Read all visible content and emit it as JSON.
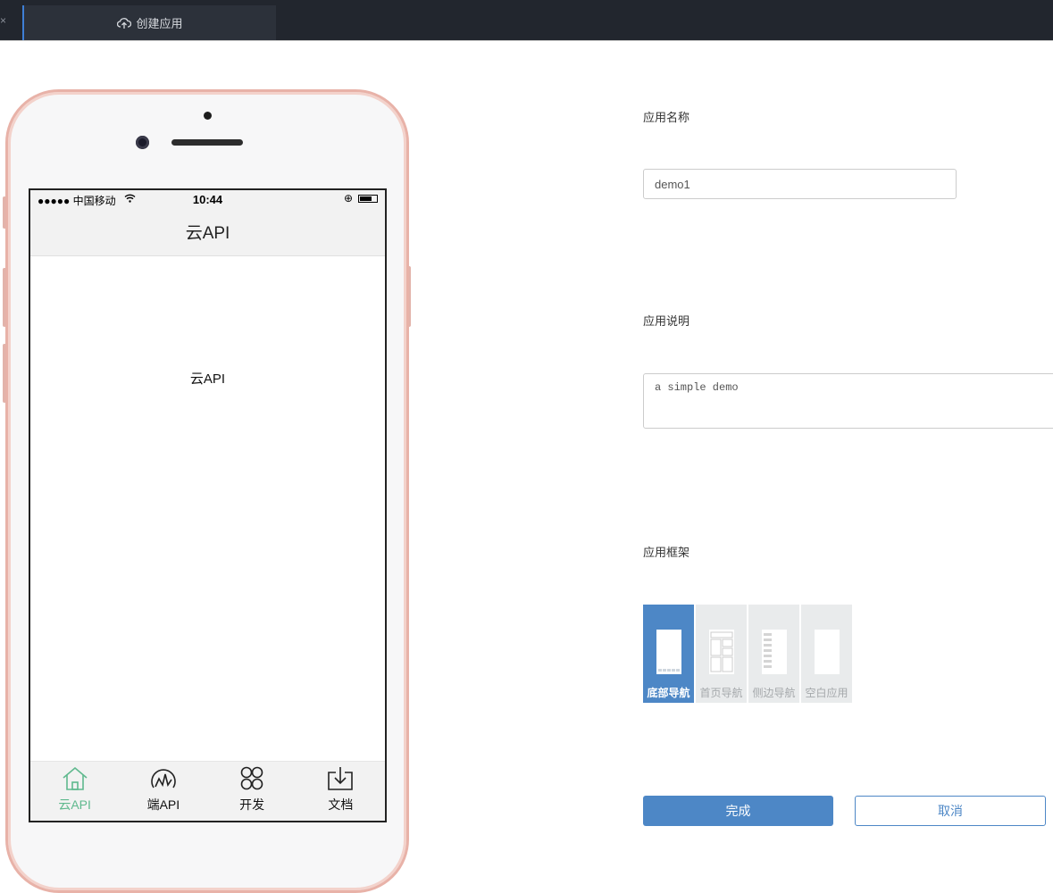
{
  "window": {
    "close_glyph": "×",
    "tab_title": "创建应用",
    "tab_icon": "cloud-upload-icon"
  },
  "phone": {
    "status": {
      "carrier": "●●●●● 中国移动",
      "time": "10:44",
      "lock": "⊕"
    },
    "nav_title": "云API",
    "content_text": "云API",
    "tabs": [
      {
        "label": "云API",
        "icon": "home-icon",
        "active": true
      },
      {
        "label": "端API",
        "icon": "signal-icon",
        "active": false
      },
      {
        "label": "开发",
        "icon": "four-circles-icon",
        "active": false
      },
      {
        "label": "文档",
        "icon": "download-tray-icon",
        "active": false
      }
    ],
    "active_color": "#5fb98e"
  },
  "form": {
    "name_label": "应用名称",
    "name_value": "demo1",
    "desc_label": "应用说明",
    "desc_value": "a simple demo",
    "frame_label": "应用框架",
    "frames": [
      {
        "name": "底部导航",
        "selected": true
      },
      {
        "name": "首页导航",
        "selected": false
      },
      {
        "name": "侧边导航",
        "selected": false
      },
      {
        "name": "空白应用",
        "selected": false
      }
    ],
    "done_label": "完成",
    "cancel_label": "取消",
    "accent": "#4d87c6"
  }
}
